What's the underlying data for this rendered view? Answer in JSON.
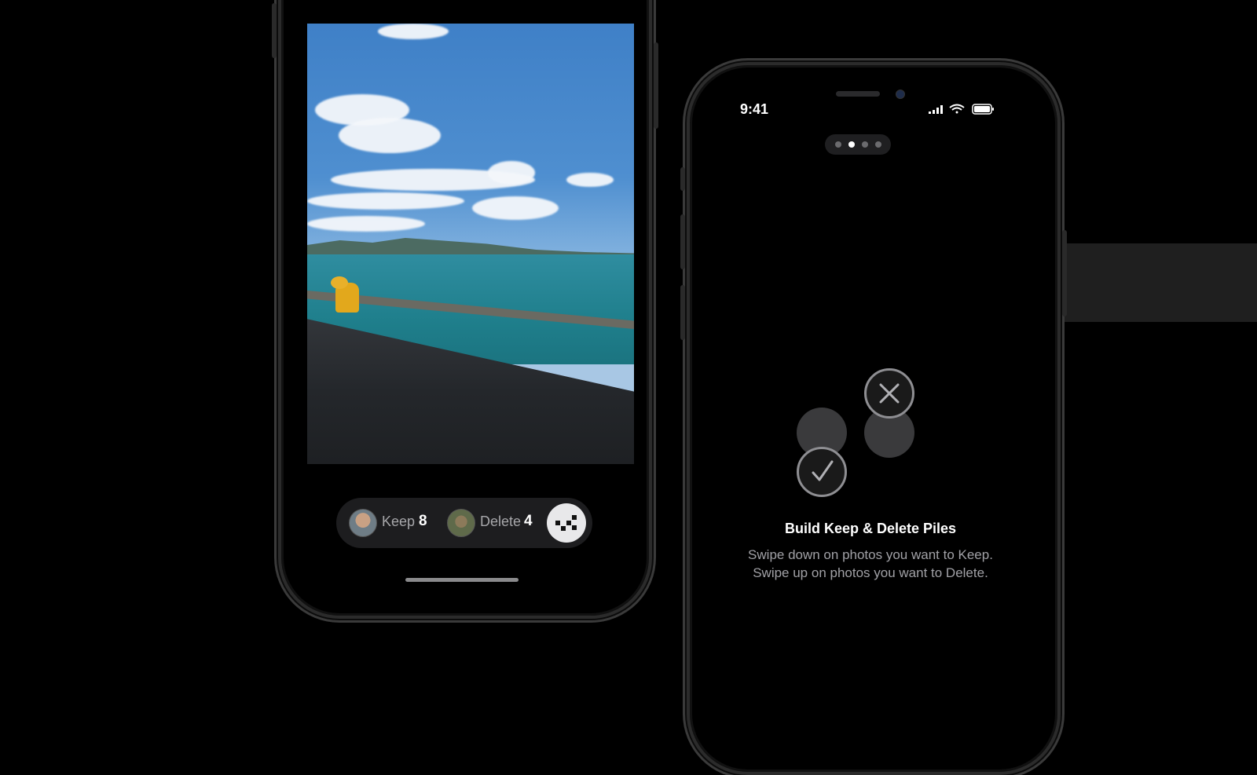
{
  "left_phone": {
    "keep": {
      "label": "Keep",
      "count": "8"
    },
    "delete": {
      "label": "Delete",
      "count": "4"
    }
  },
  "right_phone": {
    "status_bar": {
      "time": "9:41"
    },
    "page_indicator": {
      "pages": 4,
      "active": 2
    },
    "onboarding": {
      "title": "Build Keep & Delete Piles",
      "line1": "Swipe down on photos you want to Keep.",
      "line2": "Swipe up on photos you want to Delete."
    }
  }
}
